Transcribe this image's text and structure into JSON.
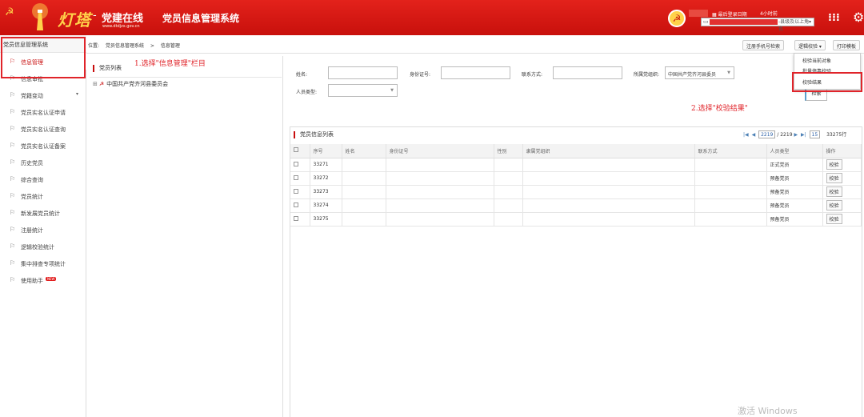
{
  "header": {
    "logo_text": "灯塔",
    "logo_dash": "-",
    "logo_subtitle": "党建在线",
    "logo_url": "www.dtdjzx.gov.cn",
    "system_title": "党员信息管理系统",
    "last_login_label": "最后登录日期",
    "last_login_time": "4小时前",
    "role_select": "-县级及以上角色"
  },
  "sidebar": {
    "title": "党员信息管理系统",
    "items": [
      {
        "label": "信息管理",
        "active": true
      },
      {
        "label": "信息审批"
      },
      {
        "label": "党籍变动",
        "has_arrow": true
      },
      {
        "label": "党员实名认证申请"
      },
      {
        "label": "党员实名认证查询"
      },
      {
        "label": "党员实名认证备案"
      },
      {
        "label": "历史党员"
      },
      {
        "label": "综合查询"
      },
      {
        "label": "党员统计"
      },
      {
        "label": "新发展党员统计"
      },
      {
        "label": "注册统计"
      },
      {
        "label": "逻辑校验统计"
      },
      {
        "label": "集中排查专项统计"
      },
      {
        "label": "使用助手",
        "badge": "NEW"
      }
    ]
  },
  "breadcrumb": {
    "label": "位置:",
    "system": "党员信息管理系统",
    "sep": ">",
    "current": "信息管理"
  },
  "toolbar": {
    "register_check": "注册手机号检索",
    "logic_check": "逻辑校验 ▾",
    "print_template": "打印模板"
  },
  "dropdown": {
    "items": [
      "校验当前对象",
      "批量停靠校验",
      "校验结果"
    ]
  },
  "org_tree": {
    "title": "党员列表",
    "annotation": "1.选择\"信息管理\"栏目",
    "root_node": "中国共产党齐河县委员会"
  },
  "search_form": {
    "name_label": "姓名:",
    "id_label": "身份证号:",
    "contact_label": "联系方式:",
    "org_label": "所属党组织:",
    "org_value": "中国共产党齐河县委员",
    "type_label": "人员类型:",
    "search_button": "检索",
    "annotation": "2.选择\"校验结果\""
  },
  "member_list": {
    "title": "党员信息列表",
    "pager": {
      "first": "|◀",
      "prev": "◀",
      "current_page": "2219",
      "total_pages": "/ 2219",
      "next": "▶",
      "last": "▶|",
      "page_size": "15",
      "total_rows": "33275行"
    },
    "columns": [
      "",
      "序号",
      "姓名",
      "身份证号",
      "性别",
      "隶属党组织",
      "联系方式",
      "人员类型",
      "操作"
    ],
    "rows": [
      {
        "seq": "33271",
        "type": "正式党员",
        "action": "校验"
      },
      {
        "seq": "33272",
        "type": "预备党员",
        "action": "校验"
      },
      {
        "seq": "33273",
        "type": "预备党员",
        "action": "校验"
      },
      {
        "seq": "33274",
        "type": "预备党员",
        "action": "校验"
      },
      {
        "seq": "33275",
        "type": "预备党员",
        "action": "校验"
      }
    ]
  },
  "watermark": "激活 Windows",
  "colors": {
    "header_red": "#c8100c",
    "accent_red": "#c80d0d",
    "annotation_red": "#e0242a",
    "logo_gold": "#ffd24a"
  }
}
